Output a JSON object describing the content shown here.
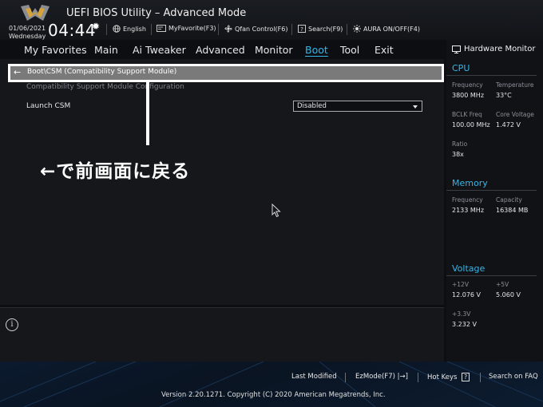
{
  "header": {
    "title": "UEFI BIOS Utility – Advanced Mode",
    "date": "01/06/2021",
    "weekday": "Wednesday",
    "time": "04:44",
    "tools": {
      "language": "English",
      "my_favorite": "MyFavorite(F3)",
      "qfan": "Qfan Control(F6)",
      "search": "Search(F9)",
      "aura": "AURA ON/OFF(F4)"
    }
  },
  "nav": {
    "tabs": [
      "My Favorites",
      "Main",
      "Ai Tweaker",
      "Advanced",
      "Monitor",
      "Boot",
      "Tool",
      "Exit"
    ],
    "active": "Boot"
  },
  "main": {
    "breadcrumb": "Boot\\CSM (Compatibility Support Module)",
    "section_label": "Compatibility Support Module Configuration",
    "setting_label": "Launch CSM",
    "setting_value": "Disabled",
    "annotation": "←で前画面に戻る"
  },
  "hardware_monitor": {
    "title": "Hardware Monitor",
    "cpu": {
      "heading": "CPU",
      "frequency_label": "Frequency",
      "frequency": "3800 MHz",
      "temperature_label": "Temperature",
      "temperature": "33°C",
      "bclk_label": "BCLK Freq",
      "bclk": "100.00 MHz",
      "core_voltage_label": "Core Voltage",
      "core_voltage": "1.472 V",
      "ratio_label": "Ratio",
      "ratio": "38x"
    },
    "memory": {
      "heading": "Memory",
      "frequency_label": "Frequency",
      "frequency": "2133 MHz",
      "capacity_label": "Capacity",
      "capacity": "16384 MB"
    },
    "voltage": {
      "heading": "Voltage",
      "v12_label": "+12V",
      "v12": "12.076 V",
      "v5_label": "+5V",
      "v5": "5.060 V",
      "v33_label": "+3.3V",
      "v33": "3.232 V"
    }
  },
  "footer": {
    "last_modified": "Last Modified",
    "ezmode": "EzMode(F7)",
    "hot_keys": "Hot Keys",
    "hot_keys_key": "?",
    "faq": "Search on FAQ",
    "version": "Version 2.20.1271. Copyright (C) 2020 American Megatrends, Inc."
  },
  "colors": {
    "accent": "#36b6e8",
    "background": "#0c0e12"
  },
  "icons": [
    "tuf-logo-icon",
    "gear-icon",
    "globe-icon",
    "favorite-icon",
    "fan-icon",
    "search-icon",
    "aura-icon",
    "monitor-icon",
    "info-icon",
    "back-arrow-icon",
    "mouse-cursor-icon",
    "ezmode-exit-icon"
  ]
}
